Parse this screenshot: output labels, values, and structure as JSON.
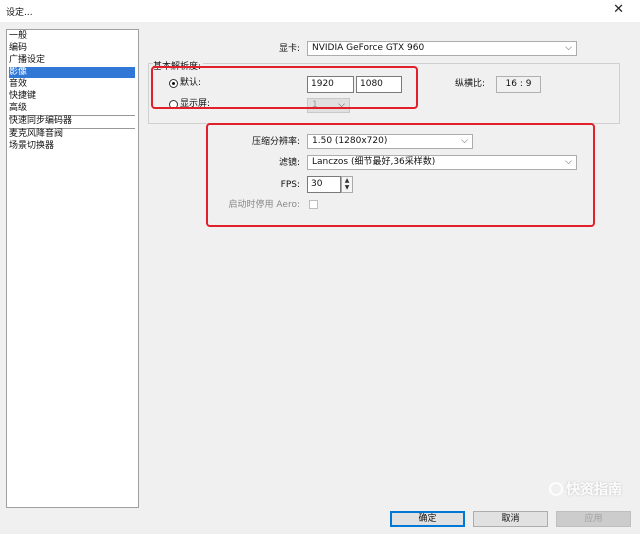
{
  "window": {
    "title": "设定...",
    "close": "✕"
  },
  "sidebar": {
    "items": [
      "一般",
      "编码",
      "广播设定",
      "影像",
      "音效",
      "快捷键",
      "高级",
      "快速同步编码器",
      "麦克风降音阀",
      "场景切换器"
    ],
    "selected": "影像"
  },
  "gpu": {
    "label": "显卡:",
    "value": "NVIDIA GeForce GTX 960"
  },
  "base_resolution": {
    "label": "基本解析度:",
    "default_label": "默认:",
    "width": "1920",
    "height": "1080",
    "aspect_label": "纵横比:",
    "aspect_value": "16 : 9",
    "monitor_label": "显示屏:",
    "monitor_value": "1"
  },
  "downscale": {
    "label": "压缩分辨率:",
    "value": "1.50  (1280x720)"
  },
  "filter": {
    "label": "滤镜:",
    "value": "Lanczos (细节最好,36采样数)"
  },
  "fps": {
    "label": "FPS:",
    "value": "30"
  },
  "aero": {
    "label": "启动时停用 Aero:"
  },
  "buttons": {
    "ok": "确定",
    "cancel": "取消",
    "apply": "应用"
  },
  "watermark": "快资指南"
}
